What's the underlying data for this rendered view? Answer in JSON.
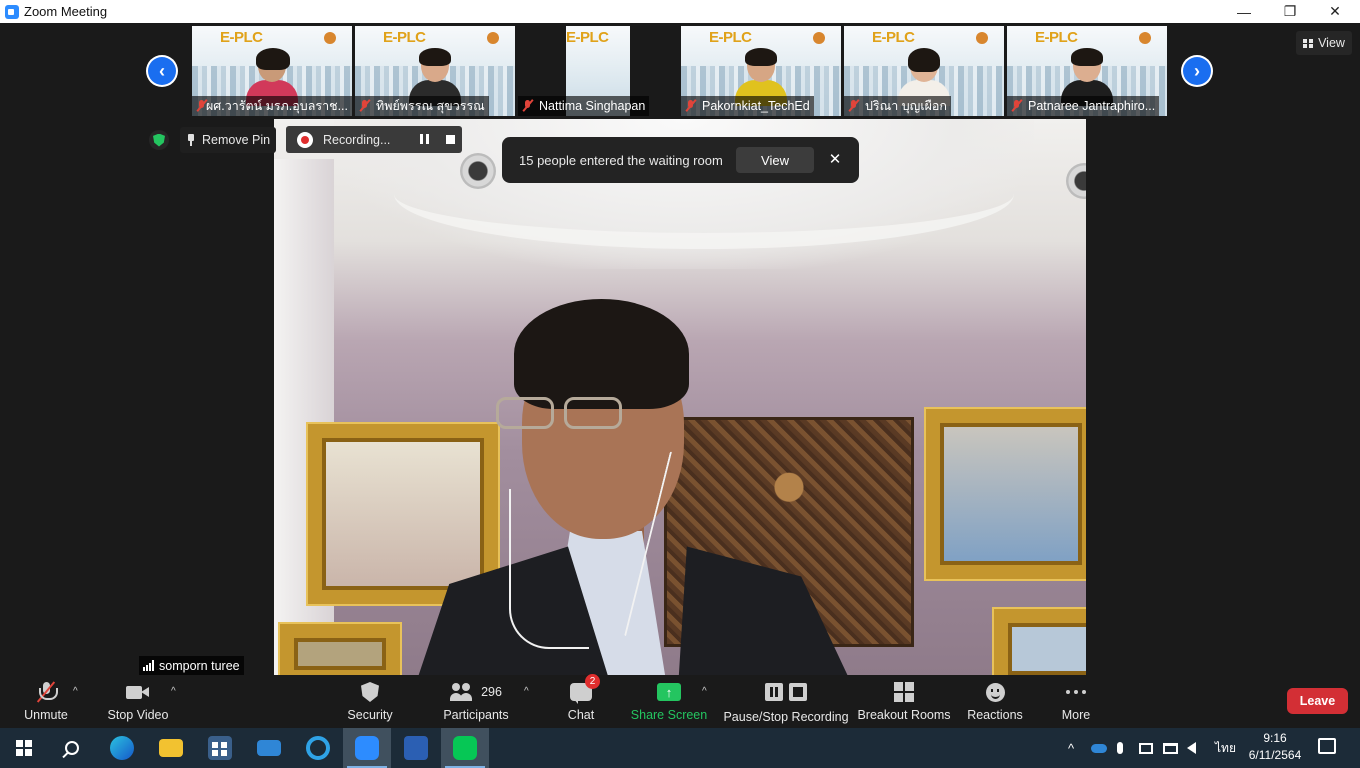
{
  "window": {
    "title": "Zoom Meeting",
    "minimize": "—",
    "maximize": "❐",
    "close": "✕"
  },
  "gallery": {
    "prev": "‹",
    "next": "›",
    "tiles": [
      {
        "name": "ผศ.วารัตน์ มรภ.อุบลราช..."
      },
      {
        "name": "ทิพย์พรรณ สุขวรรณ"
      },
      {
        "name": "Nattima Singhapan"
      },
      {
        "name": "Pakornkiat_TechEd"
      },
      {
        "name": "ปริณา บุญเผือก"
      },
      {
        "name": "Patnaree Jantraphiro..."
      }
    ],
    "logo_text": "E-PLC"
  },
  "top_right": {
    "view_label": "View"
  },
  "overlay": {
    "remove_pin": "Remove Pin",
    "recording": "Recording...",
    "waiting_message": "15 people entered the waiting room",
    "waiting_view": "View",
    "waiting_close": "✕",
    "speaker_name": "somporn turee"
  },
  "toolbar": {
    "unmute": "Unmute",
    "stop_video": "Stop Video",
    "security": "Security",
    "participants": "Participants",
    "participants_count": "296",
    "chat": "Chat",
    "chat_badge": "2",
    "share_screen": "Share Screen",
    "pause_stop_recording": "Pause/Stop Recording",
    "breakout_rooms": "Breakout Rooms",
    "reactions": "Reactions",
    "more": "More",
    "leave": "Leave",
    "caret": "^"
  },
  "taskbar": {
    "tray_lang": "ไทย",
    "clock_time": "9:16",
    "clock_date": "6/11/2564",
    "tray_chevron": "^"
  },
  "colors": {
    "accent_blue": "#2d8cff",
    "share_green": "#24c560",
    "leave_red": "#d32f35",
    "badge_red": "#e02e2e"
  }
}
